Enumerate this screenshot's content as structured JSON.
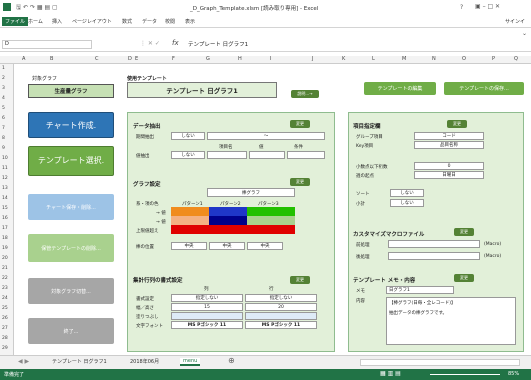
{
  "title": {
    "text": "_D_Graph_Template.xlsm [読み取り専用] - Excel",
    "help": "?",
    "signin": "サインイ"
  },
  "ribbon_tabs": [
    "ファイル",
    "ホーム",
    "挿入",
    "ページレイアウト",
    "数式",
    "データ",
    "校閲",
    "表示"
  ],
  "formula": {
    "name_box": "D",
    "fx": "fx",
    "value": "テンプレート 日グラフ1"
  },
  "columns": [
    "A",
    "B",
    "C",
    "D",
    "E",
    "F",
    "G",
    "H",
    "I",
    "J",
    "K",
    "L",
    "M",
    "N",
    "O",
    "P",
    "Q"
  ],
  "rows": [
    "1",
    "2",
    "3",
    "4",
    "5",
    "6",
    "7",
    "8",
    "9",
    "10",
    "11",
    "12",
    "13",
    "14",
    "15",
    "16",
    "17",
    "18",
    "19",
    "20",
    "21",
    "22",
    "23",
    "24",
    "25",
    "26",
    "27",
    "28",
    "29"
  ],
  "left_panel": {
    "target_label": "対象グラフ",
    "target_value": "生産量グラフ",
    "btn_create": "チャート作成.",
    "btn_template": "テンプレート選択.",
    "btn_save": "チャート保存・削除...",
    "btn_saved": "保管テンプレートの削除...",
    "btn_switch": "対象グラフ切替...",
    "btn_exit": "終了..."
  },
  "top": {
    "use_label": "使用テンプレート",
    "template_name": "テンプレート 日グラフ1",
    "small_btn": "説明...→",
    "btn_edit": "テンプレートの編集",
    "btn_save": "テンプレートの保存..."
  },
  "extract": {
    "title": "データ抽出",
    "set": "変更",
    "row1_label": "期間抽出",
    "row1_val": "しない",
    "tilde": "～",
    "row2_label": "値抽出",
    "row2_val": "しない",
    "col_item": "項目名",
    "col_val": "値",
    "col_cond": "条件"
  },
  "graph": {
    "title": "グラフ設定",
    "set": "変更",
    "type": "棒グラフ",
    "series_label": "系・項の色",
    "pat1": "パターン1",
    "pat2": "パターン2",
    "pat3": "パターン3",
    "row_a": "→ 値",
    "row_b": "→ 値",
    "row_c": "上限値超え",
    "pos_label": "棒の位置",
    "pos1": "中央",
    "pos2": "中央",
    "pos3": "中央"
  },
  "series_fmt": {
    "title": "集計行列の書式設定",
    "set": "変更",
    "col1": "列",
    "col2": "行",
    "r1_label": "書式設定",
    "r1_v1": "指定しない",
    "r1_v2": "指定しない",
    "r2_label": "幅／高さ",
    "r2_v1": "15",
    "r2_v2": "20",
    "r3_label": "塗りつぶし",
    "r4_label": "文字フォント",
    "r4_v1": "MS Pゴシック 11",
    "r4_v2": "MS Pゴシック 11"
  },
  "items": {
    "title": "項目指定欄",
    "set": "変更",
    "group_label": "グループ項目",
    "group_val": "コード",
    "key_label": "Key項目",
    "key_val": "品目名称",
    "dec_label": "小数点以下桁数",
    "dec_val": "0",
    "week_label": "週の起点",
    "week_val": "日曜日",
    "sort_label": "ソート",
    "sort_val": "しない",
    "subtotal_label": "小計",
    "subtotal_val": "しない"
  },
  "macro": {
    "title": "カスタマイズマクロファイル",
    "set": "変更",
    "pre_label": "前処理",
    "pre_note": "(Macro)",
    "post_label": "後処理",
    "post_note": "(Macro)"
  },
  "memo": {
    "title": "テンプレート メモ・内容",
    "set": "変更",
    "memo_label": "メモ",
    "memo_val": "日グラフ1",
    "content_label": "内容",
    "content_line1": "【棒グラフ(日毎・全レコード)】",
    "content_line2": "抽出データの棒グラフです。"
  },
  "sheet_tabs": [
    "テンプレート 日グラフ1",
    "2018年06月",
    "menu"
  ],
  "status": {
    "ready": "準備完了",
    "zoom": "85%"
  },
  "colors": {
    "orange": "#f08c1e",
    "blue": "#1f36c8",
    "green": "#22c000",
    "red": "#e00000"
  }
}
